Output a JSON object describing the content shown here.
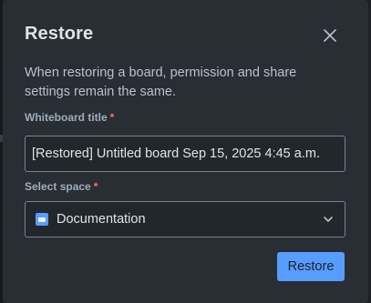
{
  "dialog": {
    "title": "Restore",
    "description": "When restoring a board, permission and share settings remain the same.",
    "close_icon": "close-icon"
  },
  "fields": {
    "title_label": "Whiteboard title",
    "title_required": "*",
    "title_value": "[Restored] Untitled board Sep 15, 2025 4:45 a.m.",
    "space_label": "Select space",
    "space_required": "*",
    "space_value": "Documentation",
    "space_icon": "space-icon",
    "dropdown_icon": "chevron-down-icon"
  },
  "actions": {
    "restore_label": "Restore"
  },
  "colors": {
    "dialog_bg": "#282e33",
    "accent": "#579dff",
    "required": "#f87168",
    "text": "#dee4ea"
  }
}
